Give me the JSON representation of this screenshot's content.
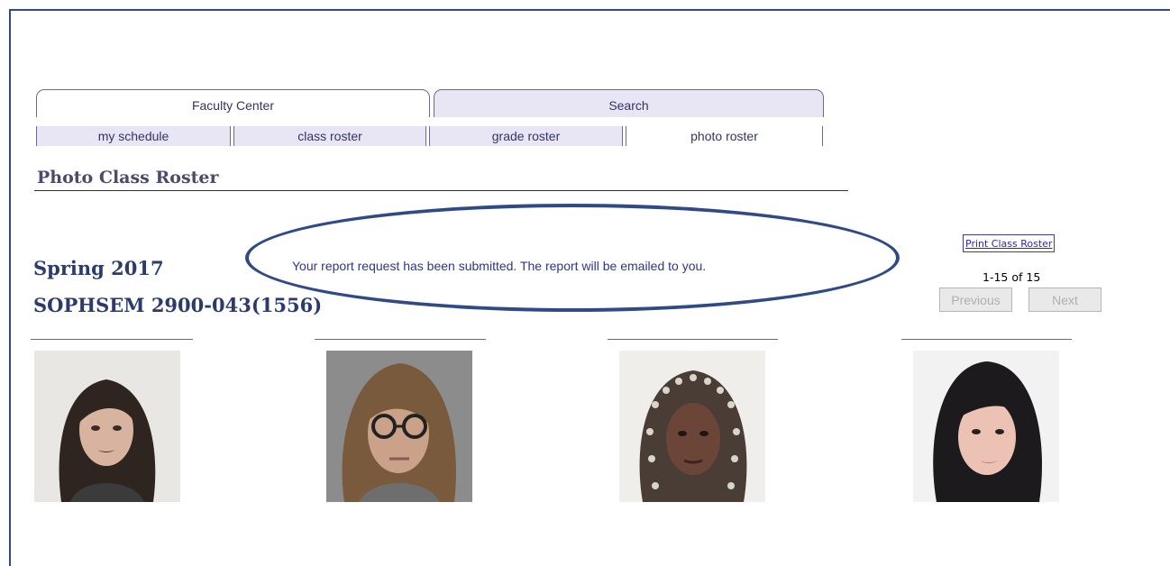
{
  "tabs": [
    {
      "label": "Faculty Center",
      "active": true
    },
    {
      "label": "Search",
      "active": false
    }
  ],
  "subtabs": [
    {
      "label": "my schedule"
    },
    {
      "label": "class roster"
    },
    {
      "label": "grade roster"
    },
    {
      "label": "photo roster",
      "active": true
    }
  ],
  "page_title": "Photo Class Roster",
  "term": "Spring 2017",
  "course": "SOPHSEM 2900-043(1556)",
  "message": "Your report request has been submitted.  The report will be emailed to you.",
  "print_link": "Print Class Roster",
  "pagination": {
    "range": "1-15 of 15",
    "previous_label": "Previous",
    "next_label": "Next"
  },
  "colors": {
    "frame": "#2f4a86",
    "tab_bg": "#e8e6f5",
    "message_text": "#2a3690",
    "heading_text": "#2b3b6e"
  },
  "photos": [
    {
      "icon": "student-photo-1"
    },
    {
      "icon": "student-photo-2"
    },
    {
      "icon": "student-photo-3"
    },
    {
      "icon": "student-photo-4"
    }
  ]
}
